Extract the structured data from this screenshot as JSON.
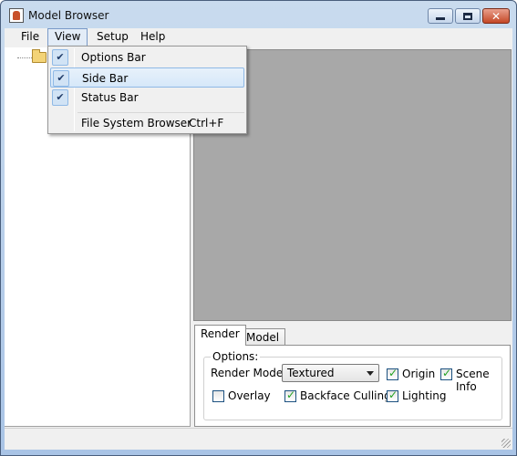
{
  "window": {
    "title": "Model Browser",
    "close_glyph": "✕"
  },
  "menubar": {
    "items": [
      "File",
      "View",
      "Setup",
      "Help"
    ]
  },
  "view_menu": {
    "items": [
      {
        "label": "Options Bar",
        "checked": true
      },
      {
        "label": "Side Bar",
        "checked": true,
        "highlighted": true
      },
      {
        "label": "Status Bar",
        "checked": true
      },
      {
        "label": "File System Browser",
        "shortcut": "Ctrl+F",
        "checked": false
      }
    ],
    "check_glyph": "✔"
  },
  "tabs": {
    "items": [
      "Render",
      "Model"
    ],
    "active": "Render"
  },
  "render_panel": {
    "group_label": "Options:",
    "render_mode_label": "Render Mode:",
    "render_mode_value": "Textured",
    "checkboxes": [
      {
        "label": "Origin",
        "checked": true
      },
      {
        "label": "Scene Info",
        "checked": true
      },
      {
        "label": "Overlay",
        "checked": false
      },
      {
        "label": "Backface Culling",
        "checked": true
      },
      {
        "label": "Lighting",
        "checked": true
      }
    ]
  },
  "icons": {
    "app": "app-icon",
    "folder": "folder-icon",
    "check": "checkmark-icon"
  },
  "colors": {
    "viewport_bg": "#a8a8a8",
    "menu_highlight": "#d6e8f9",
    "titlebar": "#c9dbee",
    "close_button": "#c44726"
  }
}
